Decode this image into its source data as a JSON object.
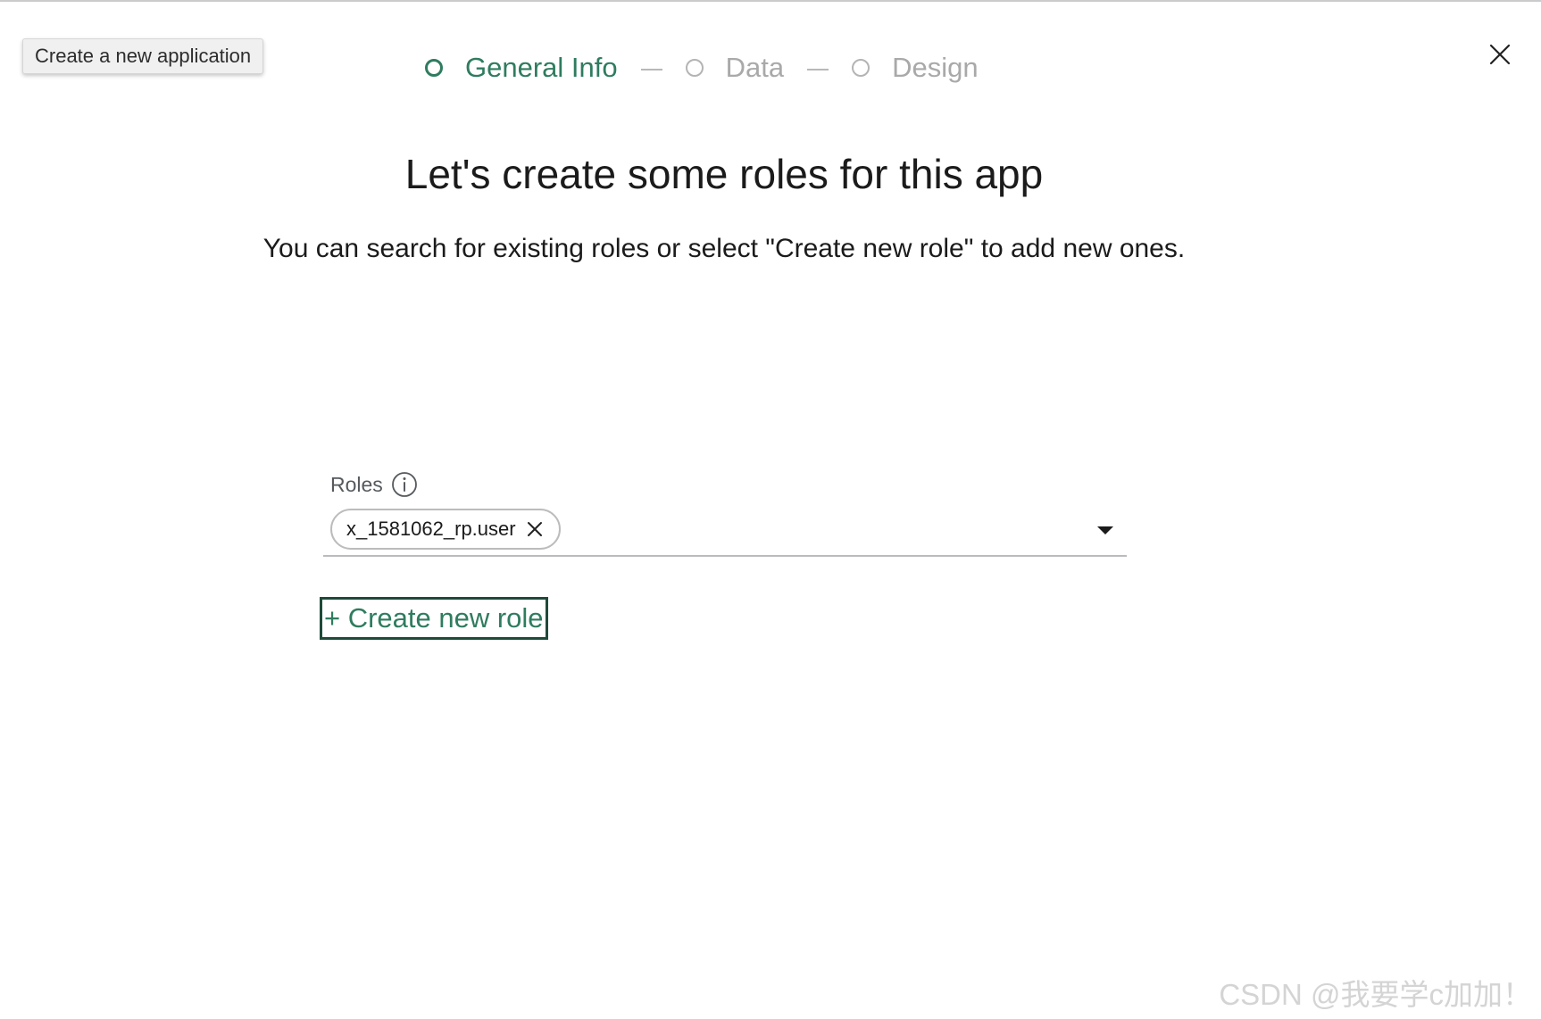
{
  "tooltip": {
    "text": "Create a new application"
  },
  "stepper": {
    "steps": [
      {
        "label": "General Info",
        "active": true
      },
      {
        "label": "Data",
        "active": false
      },
      {
        "label": "Design",
        "active": false
      }
    ]
  },
  "close": {
    "icon": "close-icon"
  },
  "header": {
    "title": "Let's create some roles for this app",
    "subtitle": "You can search for existing roles or select \"Create new role\" to add new ones."
  },
  "roles": {
    "label": "Roles",
    "info_icon": "info-icon",
    "selected": [
      {
        "value": "x_1581062_rp.user",
        "remove_icon": "close-icon"
      }
    ],
    "dropdown_icon": "caret-down-icon",
    "create_button_label": "+ Create new role"
  },
  "watermark": {
    "text": "CSDN @我要学c加加！"
  },
  "colors": {
    "accent": "#2f7c5f",
    "focus_border": "#1f4a3a",
    "inactive_step": "#a9a9a9",
    "text": "#1b1b1b",
    "label": "#555a5e"
  }
}
